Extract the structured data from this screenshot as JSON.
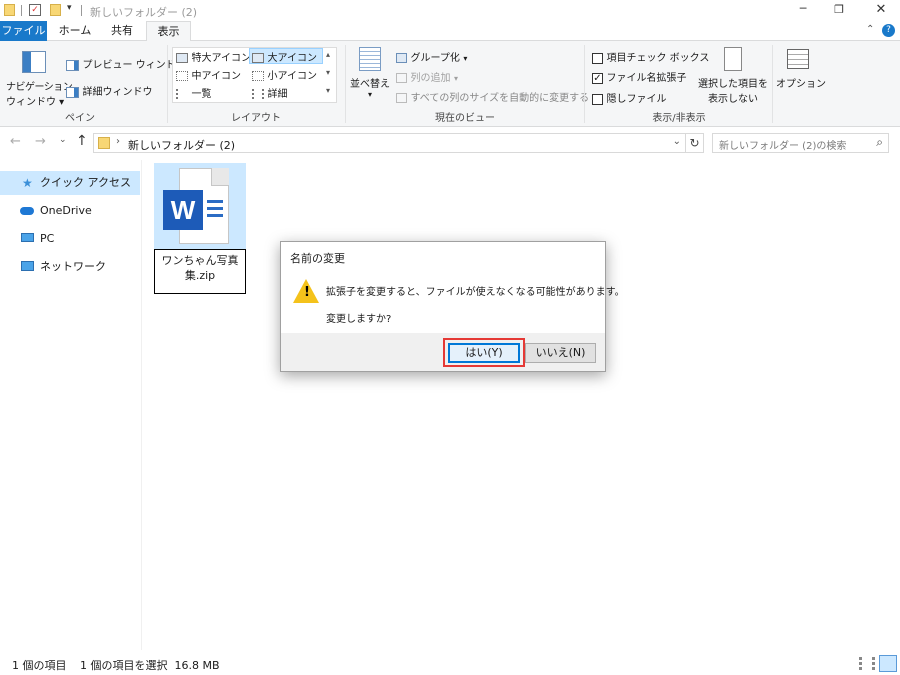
{
  "window": {
    "title": "新しいフォルダー (2)",
    "controls": [
      "minimize",
      "restore",
      "close"
    ]
  },
  "ribbon_tabs": [
    {
      "label": "ファイル",
      "active": false,
      "accent": true
    },
    {
      "label": "ホーム",
      "active": false
    },
    {
      "label": "共有",
      "active": false
    },
    {
      "label": "表示",
      "active": true
    }
  ],
  "ribbon": {
    "pane": {
      "nav_pane_line1": "ナビゲーション",
      "nav_pane_line2": "ウィンドウ",
      "preview": "プレビュー ウィンドウ",
      "details": "詳細ウィンドウ",
      "group_label": "ペイン"
    },
    "layout": {
      "items": [
        "特大アイコン",
        "大アイコン",
        "中アイコン",
        "小アイコン",
        "一覧",
        "詳細"
      ],
      "selected": "大アイコン",
      "group_label": "レイアウト"
    },
    "current_view": {
      "sort_line1": "並べ替え",
      "group_by": "グループ化",
      "add_column": "列の追加",
      "fit_columns": "すべての列のサイズを自動的に変更する",
      "group_label": "現在のビュー"
    },
    "show_hide": {
      "item_checkboxes": {
        "label": "項目チェック ボックス",
        "checked": false
      },
      "file_extensions": {
        "label": "ファイル名拡張子",
        "checked": true
      },
      "hidden_items": {
        "label": "隠しファイル",
        "checked": false
      },
      "hide_selected_line1": "選択した項目を",
      "hide_selected_line2": "表示しない",
      "group_label": "表示/非表示"
    },
    "options": "オプション"
  },
  "address": {
    "path": "新しいフォルダー (2)",
    "search_placeholder": "新しいフォルダー (2)の検索"
  },
  "nav": [
    {
      "label": "クイック アクセス",
      "icon": "star-icon",
      "selected": true
    },
    {
      "label": "OneDrive",
      "icon": "cloud-icon",
      "selected": false
    },
    {
      "label": "PC",
      "icon": "monitor-icon",
      "selected": false
    },
    {
      "label": "ネットワーク",
      "icon": "network-icon",
      "selected": false
    }
  ],
  "file": {
    "name_line1": "ワンちゃん写真",
    "name_line2": "集.zip",
    "icon": "word-document-icon"
  },
  "dialog": {
    "title": "名前の変更",
    "message": "拡張子を変更すると、ファイルが使えなくなる可能性があります。",
    "question": "変更しますか?",
    "yes_label": "はい(Y)",
    "no_label": "いいえ(N)"
  },
  "status": {
    "item_count": "1 個の項目",
    "selection": "1 個の項目を選択  16.8 MB"
  },
  "colors": {
    "accent": "#1979ca",
    "highlight": "#e53935",
    "selection": "#cce8ff"
  }
}
